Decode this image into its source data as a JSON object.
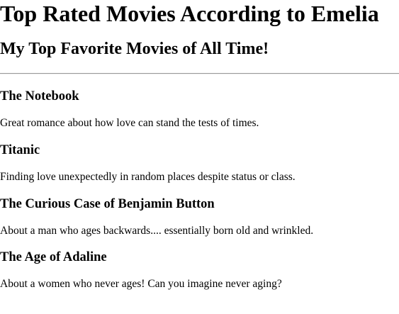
{
  "page": {
    "title": "Top Rated Movies According to Emelia",
    "subtitle": "My Top Favorite Movies of All Time!"
  },
  "movies": [
    {
      "title": "The Notebook",
      "description": "Great romance about how love can stand the tests of times."
    },
    {
      "title": "Titanic",
      "description": "Finding love unexpectedly in random places despite status or class."
    },
    {
      "title": "The Curious Case of Benjamin Button",
      "description": "About a man who ages backwards.... essentially born old and wrinkled."
    },
    {
      "title": "The Age of Adaline",
      "description": "About a women who never ages! Can you imagine never aging?"
    }
  ]
}
